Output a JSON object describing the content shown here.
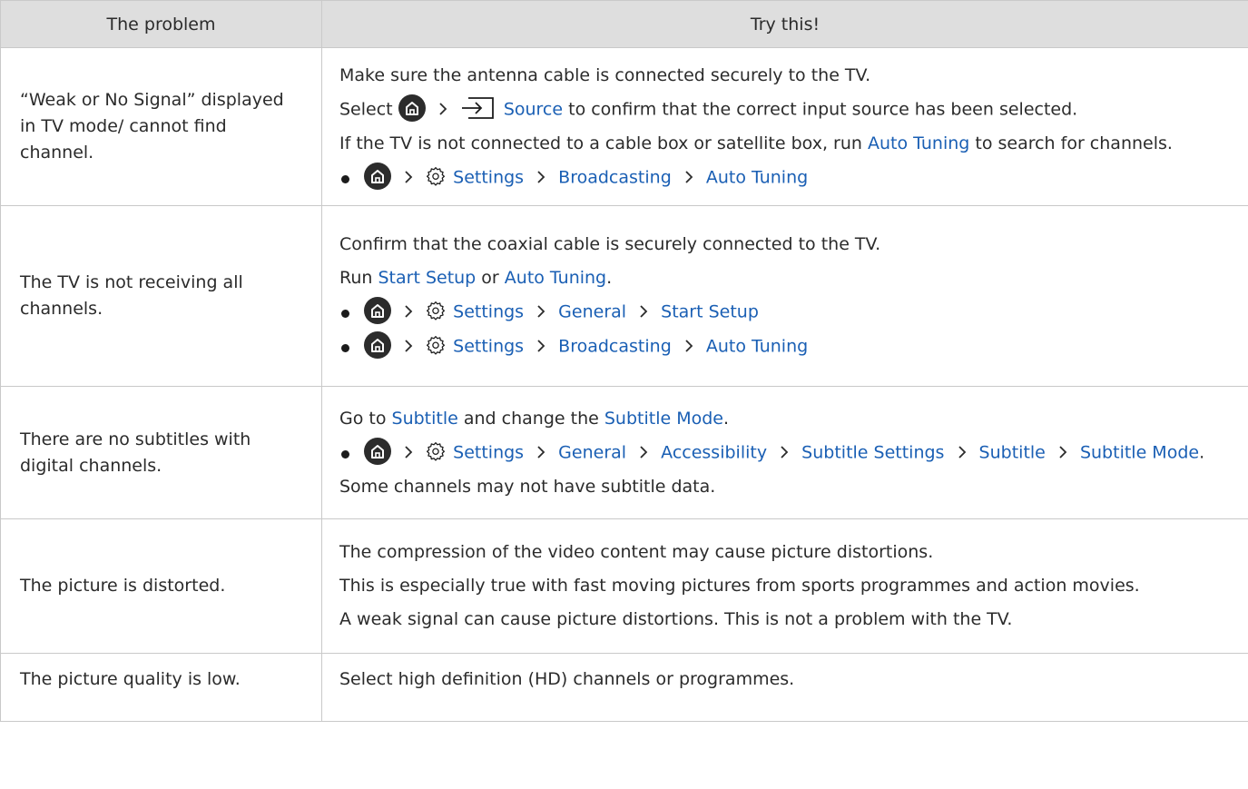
{
  "table": {
    "header": {
      "problem": "The problem",
      "solution": "Try this!"
    },
    "rows": [
      {
        "problem": "“Weak or No Signal” displayed in TV mode/ cannot find channel.",
        "l1": "Make sure the antenna cable is connected securely to the TV.",
        "l2": {
          "pre": "Select",
          "link": "Source",
          "post": "to confirm that the correct input source has been selected."
        },
        "l3": {
          "pre": "If the TV is not connected to a cable box or satellite box, run",
          "link": "Auto Tuning",
          "post": "to search for channels."
        },
        "path": [
          "Settings",
          "Broadcasting",
          "Auto Tuning"
        ]
      },
      {
        "problem": "The TV is not receiving all channels.",
        "l1": "Confirm that the coaxial cable is securely connected to the TV.",
        "l2": {
          "pre": "Run",
          "link1": "Start Setup",
          "mid": "or",
          "link2": "Auto Tuning",
          "end": "."
        },
        "path1": [
          "Settings",
          "General",
          "Start Setup"
        ],
        "path2": [
          "Settings",
          "Broadcasting",
          "Auto Tuning"
        ]
      },
      {
        "problem": "There are no subtitles with digital channels.",
        "l1": {
          "pre": "Go to",
          "link1": "Subtitle",
          "mid": "and change the",
          "link2": "Subtitle Mode",
          "end": "."
        },
        "path": [
          "Settings",
          "General",
          "Accessibility",
          "Subtitle Settings",
          "Subtitle",
          "Subtitle Mode"
        ],
        "l3": "Some channels may not have subtitle data."
      },
      {
        "problem": "The picture is distorted.",
        "l1": "The compression of the video content may cause picture distortions.",
        "l2": "This is especially true with fast moving pictures from sports programmes and action movies.",
        "l3": "A weak signal can cause picture distortions. This is not a problem with the TV."
      },
      {
        "problem": "The picture quality is low.",
        "l1": "Select high definition (HD) channels or programmes."
      }
    ]
  },
  "icons": {
    "home": "home-icon",
    "settings": "gear-icon",
    "source": "source-input-icon",
    "separator": "chevron-right-icon"
  },
  "colors": {
    "link": "#1a5fb4",
    "header_bg": "#dedede",
    "border": "#c9c9c9",
    "text": "#2b2b2b"
  }
}
